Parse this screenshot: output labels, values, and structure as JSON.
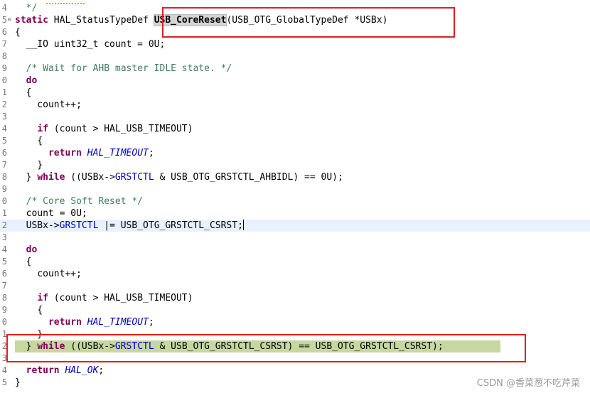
{
  "editor": {
    "lines": [
      {
        "ln": "4",
        "tokens": [
          {
            "t": "  */",
            "c": "cm"
          }
        ]
      },
      {
        "ln": "5",
        "fold": "⊖",
        "tokens": [
          {
            "t": "static ",
            "c": "kw"
          },
          {
            "t": "HAL_StatusTypeDef ",
            "c": "pl"
          },
          {
            "t": "USB_CoreReset",
            "c": "mark"
          },
          {
            "t": "(USB_OTG_GlobalTypeDef *USBx)",
            "c": "pl"
          }
        ]
      },
      {
        "ln": "6",
        "tokens": [
          {
            "t": "{",
            "c": "pl"
          }
        ]
      },
      {
        "ln": "7",
        "tokens": [
          {
            "t": "  __IO uint32_t count = 0U;",
            "c": "pl"
          }
        ]
      },
      {
        "ln": "8",
        "tokens": []
      },
      {
        "ln": "9",
        "tokens": [
          {
            "t": "  /* Wait for AHB master IDLE state. */",
            "c": "cm"
          }
        ]
      },
      {
        "ln": "0",
        "tokens": [
          {
            "t": "  ",
            "c": "pl"
          },
          {
            "t": "do",
            "c": "kw"
          }
        ]
      },
      {
        "ln": "1",
        "tokens": [
          {
            "t": "  {",
            "c": "pl"
          }
        ]
      },
      {
        "ln": "2",
        "tokens": [
          {
            "t": "    count++;",
            "c": "pl"
          }
        ]
      },
      {
        "ln": "3",
        "tokens": []
      },
      {
        "ln": "4",
        "tokens": [
          {
            "t": "    ",
            "c": "pl"
          },
          {
            "t": "if",
            "c": "kw"
          },
          {
            "t": " (count > HAL_USB_TIMEOUT)",
            "c": "pl"
          }
        ]
      },
      {
        "ln": "5",
        "tokens": [
          {
            "t": "    {",
            "c": "pl"
          }
        ]
      },
      {
        "ln": "6",
        "tokens": [
          {
            "t": "      ",
            "c": "pl"
          },
          {
            "t": "return",
            "c": "kw"
          },
          {
            "t": " ",
            "c": "pl"
          },
          {
            "t": "HAL_TIMEOUT",
            "c": "it"
          },
          {
            "t": ";",
            "c": "pl"
          }
        ]
      },
      {
        "ln": "7",
        "tokens": [
          {
            "t": "    }",
            "c": "pl"
          }
        ]
      },
      {
        "ln": "8",
        "tokens": [
          {
            "t": "  } ",
            "c": "pl"
          },
          {
            "t": "while",
            "c": "kw"
          },
          {
            "t": " ((USBx->",
            "c": "pl"
          },
          {
            "t": "GRSTCTL",
            "c": "fld"
          },
          {
            "t": " & USB_OTG_GRSTCTL_AHBIDL) == 0U);",
            "c": "pl"
          }
        ]
      },
      {
        "ln": "9",
        "tokens": []
      },
      {
        "ln": "0",
        "tokens": [
          {
            "t": "  /* Core Soft Reset */",
            "c": "cm"
          }
        ]
      },
      {
        "ln": "1",
        "tokens": [
          {
            "t": "  count = 0U;",
            "c": "pl"
          }
        ]
      },
      {
        "ln": "2",
        "current": true,
        "tokens": [
          {
            "t": "  USBx->",
            "c": "pl"
          },
          {
            "t": "GRSTCTL",
            "c": "fld"
          },
          {
            "t": " |= USB_OTG_GRSTCTL_CSRST;",
            "c": "pl"
          },
          {
            "t": "",
            "c": "caret"
          }
        ]
      },
      {
        "ln": "3",
        "tokens": []
      },
      {
        "ln": "4",
        "tokens": [
          {
            "t": "  ",
            "c": "pl"
          },
          {
            "t": "do",
            "c": "kw"
          }
        ]
      },
      {
        "ln": "5",
        "tokens": [
          {
            "t": "  {",
            "c": "pl"
          }
        ]
      },
      {
        "ln": "6",
        "tokens": [
          {
            "t": "    count++;",
            "c": "pl"
          }
        ]
      },
      {
        "ln": "7",
        "tokens": []
      },
      {
        "ln": "8",
        "tokens": [
          {
            "t": "    ",
            "c": "pl"
          },
          {
            "t": "if",
            "c": "kw"
          },
          {
            "t": " (count > HAL_USB_TIMEOUT)",
            "c": "pl"
          }
        ]
      },
      {
        "ln": "9",
        "tokens": [
          {
            "t": "    {",
            "c": "pl"
          }
        ]
      },
      {
        "ln": "0",
        "tokens": [
          {
            "t": "      ",
            "c": "pl"
          },
          {
            "t": "return",
            "c": "kw"
          },
          {
            "t": " ",
            "c": "pl"
          },
          {
            "t": "HAL_TIMEOUT",
            "c": "it"
          },
          {
            "t": ";",
            "c": "pl"
          }
        ]
      },
      {
        "ln": "1",
        "tokens": [
          {
            "t": "    }",
            "c": "pl"
          }
        ]
      },
      {
        "ln": "2",
        "match": true,
        "tokens": [
          {
            "t": "  } ",
            "c": "pl"
          },
          {
            "t": "while",
            "c": "kw"
          },
          {
            "t": " ((USBx->",
            "c": "pl"
          },
          {
            "t": "GRSTCTL",
            "c": "fld"
          },
          {
            "t": " & USB_OTG_GRSTCTL_CSRST) == USB_OTG_GRSTCTL_CSRST);",
            "c": "pl"
          }
        ]
      },
      {
        "ln": "3",
        "tokens": []
      },
      {
        "ln": "4",
        "tokens": [
          {
            "t": "  ",
            "c": "pl"
          },
          {
            "t": "return",
            "c": "kw"
          },
          {
            "t": " ",
            "c": "pl"
          },
          {
            "t": "HAL_OK",
            "c": "it"
          },
          {
            "t": ";",
            "c": "pl"
          }
        ]
      },
      {
        "ln": "5",
        "tokens": [
          {
            "t": "}",
            "c": "pl"
          }
        ]
      }
    ]
  },
  "watermark": "CSDN @香菜葱不吃芹菜",
  "colors": {
    "keyword": "#7f0055",
    "comment": "#3f7f5f",
    "field": "#0000c0",
    "highlight_box": "#e02020",
    "match_background": "#c7d7a0",
    "current_line": "#e8f2fe"
  }
}
